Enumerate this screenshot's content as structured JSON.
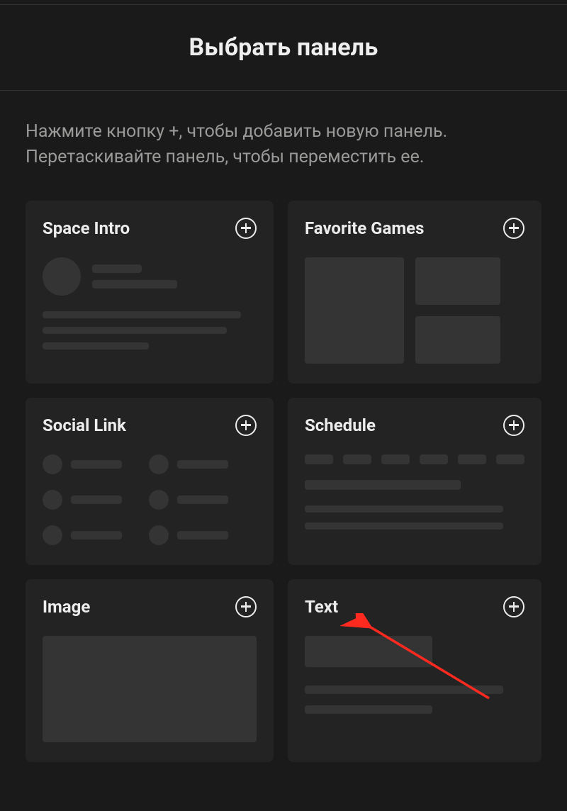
{
  "header": {
    "title": "Выбрать панель"
  },
  "instructions": "Нажмите кнопку +, чтобы добавить новую панель. Перетаскивайте панель, чтобы переместить ее.",
  "panels": [
    {
      "key": "space_intro",
      "title": "Space Intro"
    },
    {
      "key": "favorite_games",
      "title": "Favorite Games"
    },
    {
      "key": "social_link",
      "title": "Social Link"
    },
    {
      "key": "schedule",
      "title": "Schedule"
    },
    {
      "key": "image",
      "title": "Image"
    },
    {
      "key": "text",
      "title": "Text"
    }
  ],
  "annotation": {
    "target_panel": "text",
    "color": "#ff2a1f"
  }
}
